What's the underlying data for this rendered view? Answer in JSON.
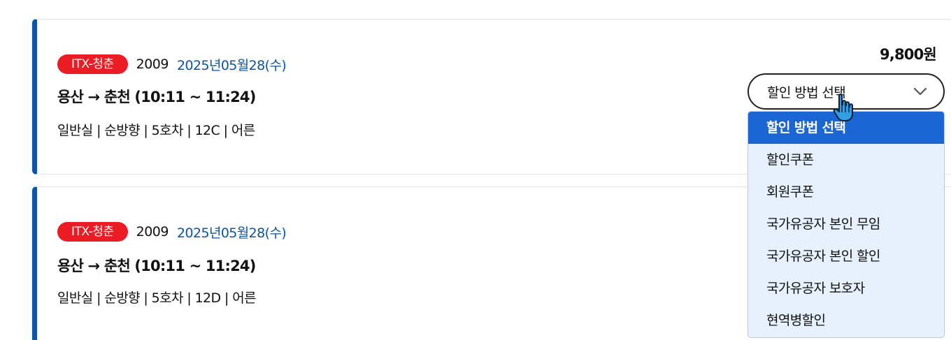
{
  "tickets": [
    {
      "badge": "ITX-청춘",
      "train_no": "2009",
      "date": "2025년05월28(수)",
      "route": "용산 → 춘천 (10:11 ~ 11:24)",
      "seat_info": "일반실 | 순방향 | 5호차 | 12C | 어른",
      "price": "9,800원"
    },
    {
      "badge": "ITX-청춘",
      "train_no": "2009",
      "date": "2025년05월28(수)",
      "route": "용산 → 춘천 (10:11 ~ 11:24)",
      "seat_info": "일반실 | 순방향 | 5호차 | 12D | 어른"
    }
  ],
  "discount_select": {
    "selected": "할인 방법 선택",
    "options": [
      "할인 방법 선택",
      "할인쿠폰",
      "회원쿠폰",
      "국가유공자 본인 무임",
      "국가유공자 본인 할인",
      "국가유공자 보호자",
      "현역병할인"
    ]
  },
  "colors": {
    "accent_blue": "#0a55a6",
    "badge_red": "#ec1c24",
    "option_selected": "#1a66d4",
    "dropdown_bg": "#e6f1fd"
  },
  "icons": {
    "select_arrow": "chevron-down-icon",
    "pointer": "hand-cursor-icon"
  }
}
